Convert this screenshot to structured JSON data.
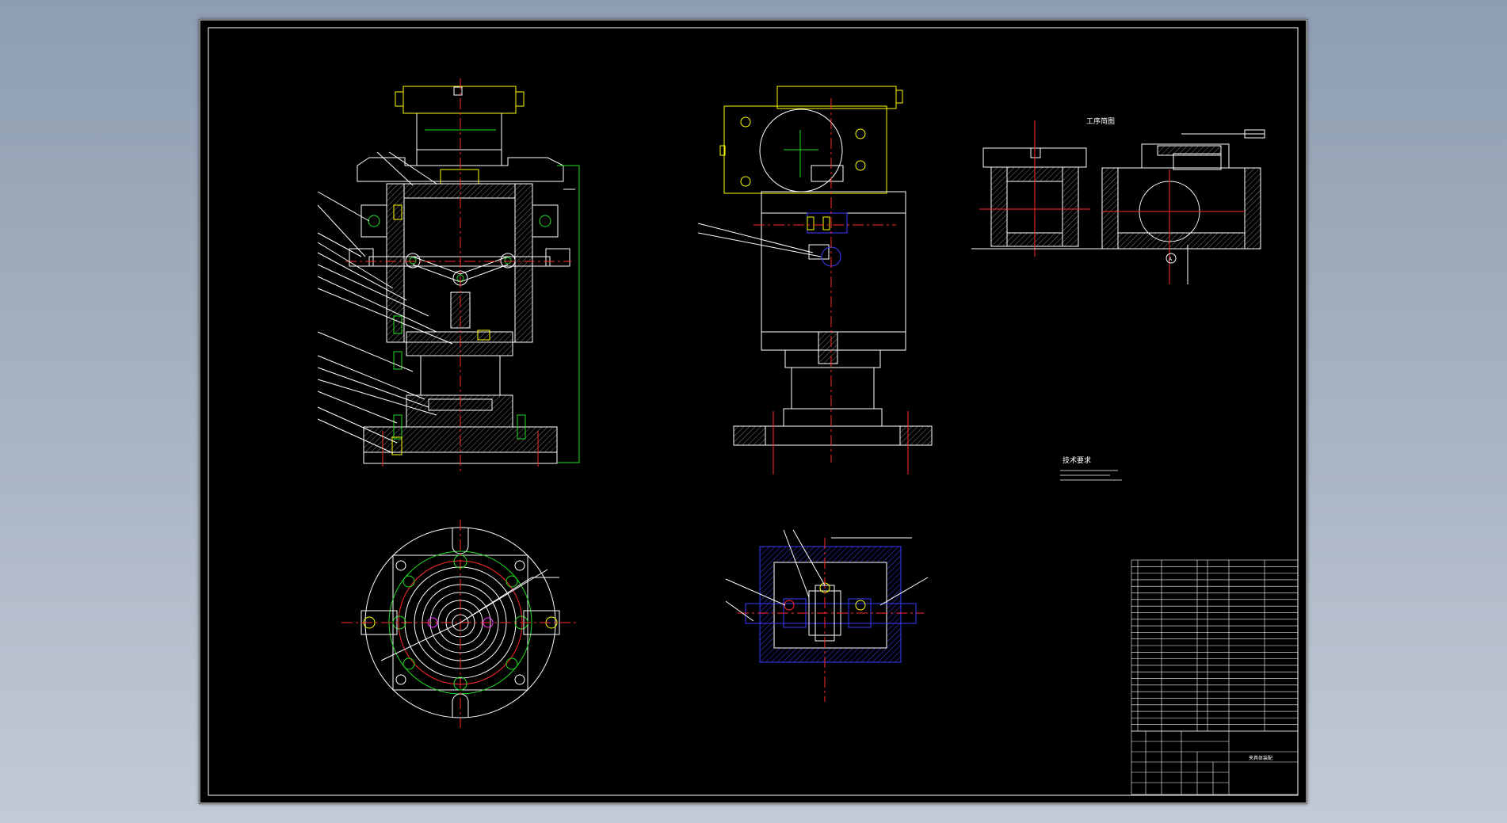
{
  "sheet": {
    "background": "#000000"
  },
  "colors": {
    "border": "#ffffff",
    "outline": "#ffffff",
    "center": "#ff2a2a",
    "hatch": "#7a7a7a",
    "yellow": "#ffff00",
    "cyan": "#22ffff",
    "green": "#22dd22",
    "blue": "#3a3aff",
    "magenta": "#ff33ff",
    "gray_bg": "#9aa6b8"
  },
  "labels": {
    "view_workpiece": "工序简图",
    "tech_title": "技术要求",
    "section_label": "A",
    "title_block_name": "夹具体装配"
  },
  "parts_table": {
    "rows": 26,
    "columns": 6
  }
}
